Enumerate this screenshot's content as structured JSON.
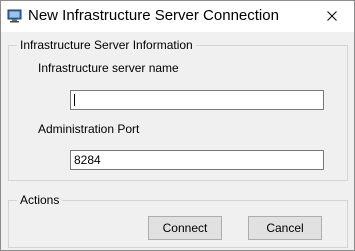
{
  "window": {
    "title": "New Infrastructure Server Connection",
    "icon": "server-connection-icon",
    "close_icon": "close-icon"
  },
  "info_group": {
    "legend": "Infrastructure Server Information",
    "server_name_label": "Infrastructure server name",
    "server_name_value": "",
    "port_label": "Administration Port",
    "port_value": "8284"
  },
  "actions_group": {
    "legend": "Actions",
    "connect_label": "Connect",
    "cancel_label": "Cancel"
  },
  "colors": {
    "dialog_bg": "#f0f0f0",
    "titlebar_bg": "#ffffff",
    "button_bg": "#e1e1e1",
    "group_border": "#d5d5d5"
  }
}
